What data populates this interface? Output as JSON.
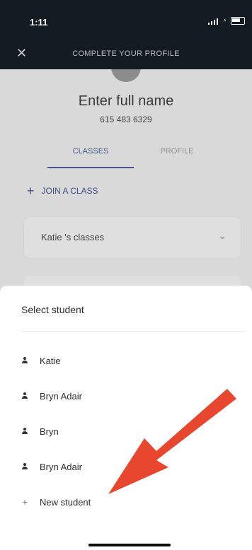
{
  "status": {
    "time": "1:11"
  },
  "header": {
    "title": "COMPLETE YOUR PROFILE",
    "close_icon": "close-icon"
  },
  "profile": {
    "name": "Enter full name",
    "phone": "615 483 6329"
  },
  "tabs": [
    {
      "label": "CLASSES",
      "active": true
    },
    {
      "label": "PROFILE",
      "active": false
    }
  ],
  "join_class": {
    "label": "JOIN A CLASS"
  },
  "classes_dropdown": {
    "label": "Katie 's classes"
  },
  "sheet": {
    "title": "Select student",
    "students": [
      {
        "label": "Katie"
      },
      {
        "label": "Bryn Adair"
      },
      {
        "label": "Bryn"
      },
      {
        "label": "Bryn Adair"
      }
    ],
    "new_student": "New student"
  },
  "colors": {
    "accent": "#3e4e85",
    "header_bg": "#121c22",
    "arrow": "#e8462f"
  }
}
